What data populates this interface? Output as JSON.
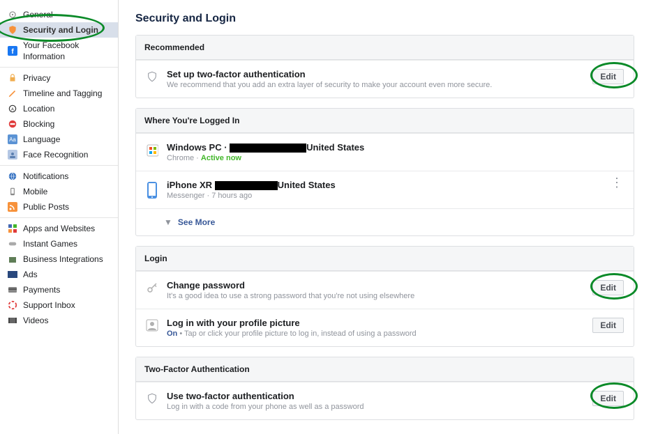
{
  "page_title": "Security and Login",
  "sidebar": {
    "groups": [
      [
        {
          "label": "General",
          "icon": "gear"
        },
        {
          "label": "Security and Login",
          "icon": "shield-orange",
          "active": true
        },
        {
          "label": "Your Facebook Information",
          "icon": "fb"
        }
      ],
      [
        {
          "label": "Privacy",
          "icon": "lock"
        },
        {
          "label": "Timeline and Tagging",
          "icon": "pencil"
        },
        {
          "label": "Location",
          "icon": "location"
        },
        {
          "label": "Blocking",
          "icon": "block"
        },
        {
          "label": "Language",
          "icon": "language"
        },
        {
          "label": "Face Recognition",
          "icon": "face"
        }
      ],
      [
        {
          "label": "Notifications",
          "icon": "globe"
        },
        {
          "label": "Mobile",
          "icon": "mobile"
        },
        {
          "label": "Public Posts",
          "icon": "rss"
        }
      ],
      [
        {
          "label": "Apps and Websites",
          "icon": "apps"
        },
        {
          "label": "Instant Games",
          "icon": "games"
        },
        {
          "label": "Business Integrations",
          "icon": "business"
        },
        {
          "label": "Ads",
          "icon": "ads"
        },
        {
          "label": "Payments",
          "icon": "payments"
        },
        {
          "label": "Support Inbox",
          "icon": "support"
        },
        {
          "label": "Videos",
          "icon": "videos"
        }
      ]
    ]
  },
  "sections": {
    "recommended": {
      "header": "Recommended",
      "item": {
        "title": "Set up two-factor authentication",
        "sub": "We recommend that you add an extra layer of security to make your account even more secure.",
        "edit": "Edit"
      }
    },
    "logged_in": {
      "header": "Where You're Logged In",
      "sessions": [
        {
          "device": "Windows PC",
          "location_suffix": "United States",
          "sub_prefix": "Chrome · ",
          "sub_active": "Active now",
          "icon": "pc"
        },
        {
          "device": "iPhone XR",
          "location_suffix": "United States",
          "sub": "Messenger · 7 hours ago",
          "icon": "iphone",
          "menu": true
        }
      ],
      "see_more": "See More"
    },
    "login": {
      "header": "Login",
      "items": [
        {
          "title": "Change password",
          "sub": "It's a good idea to use a strong password that you're not using elsewhere",
          "edit": "Edit",
          "icon": "key"
        },
        {
          "title": "Log in with your profile picture",
          "sub_on": "On",
          "sub_rest": " • Tap or click your profile picture to log in, instead of using a password",
          "edit": "Edit",
          "icon": "avatar"
        }
      ]
    },
    "two_factor": {
      "header": "Two-Factor Authentication",
      "item": {
        "title": "Use two-factor authentication",
        "sub": "Log in with a code from your phone as well as a password",
        "edit": "Edit",
        "icon": "shield"
      }
    }
  }
}
